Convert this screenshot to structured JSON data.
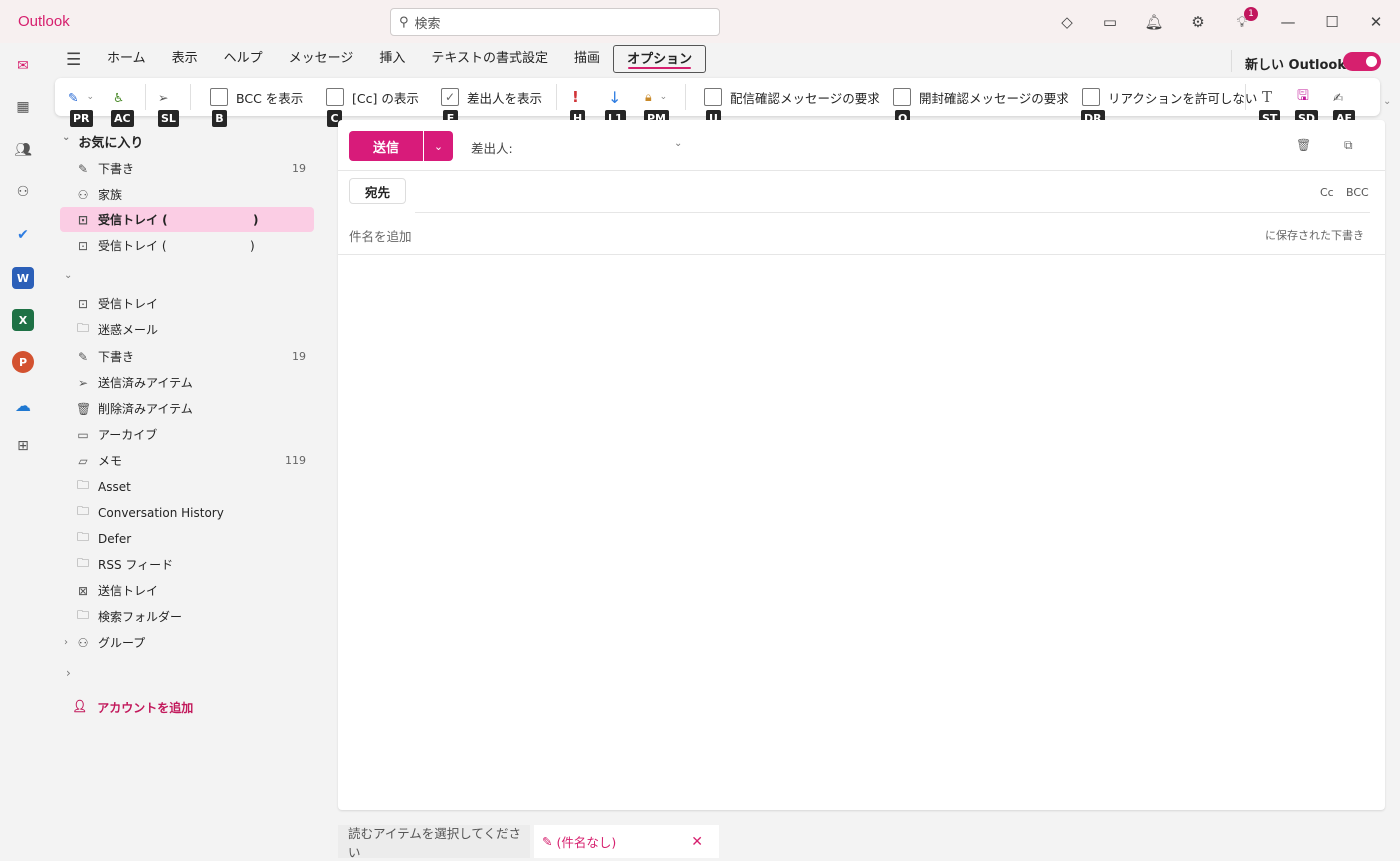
{
  "app": {
    "title": "Outlook",
    "accent": "#d6206e"
  },
  "search": {
    "placeholder": "検索"
  },
  "titlebar": {
    "notification_count": "1",
    "icons": [
      "premium-diamond-icon",
      "my-day-icon",
      "bell-icon",
      "gear-icon",
      "lightbulb-icon"
    ]
  },
  "tabs": [
    "ホーム",
    "表示",
    "ヘルプ",
    "メッセージ",
    "挿入",
    "テキストの書式設定",
    "描画",
    "オプション"
  ],
  "active_tab": "オプション",
  "new_outlook": {
    "label": "新しい Outlook",
    "enabled": true
  },
  "ribbon": {
    "bcc": {
      "label": "BCC を表示",
      "checked": false,
      "keytip": "B"
    },
    "cc": {
      "label": "[Cc] の表示",
      "checked": false,
      "keytip": "C"
    },
    "from": {
      "label": "差出人を表示",
      "checked": true,
      "keytip": "F"
    },
    "delivery": {
      "label": "配信確認メッセージの要求",
      "checked": false,
      "keytip": "U"
    },
    "read": {
      "label": "開封確認メッセージの要求",
      "checked": false,
      "keytip": "Q"
    },
    "reactions": {
      "label": "リアクションを許可しない",
      "checked": false,
      "keytip": "DR"
    },
    "keytips": {
      "pr": "PR",
      "ac": "AC",
      "sl": "SL",
      "h": "H",
      "l1": "L1",
      "pm": "PM",
      "st": "ST",
      "sd": "SD",
      "af": "AF"
    }
  },
  "folders": {
    "favorites_label": "お気に入り",
    "favorites": [
      {
        "name": "下書き",
        "count": "19"
      },
      {
        "name": "家族"
      },
      {
        "name": "受信トレイ (",
        "suffix": ")"
      },
      {
        "name": "受信トレイ (",
        "suffix": ")"
      }
    ],
    "account": [
      {
        "name": "受信トレイ"
      },
      {
        "name": "迷惑メール"
      },
      {
        "name": "下書き",
        "count": "19"
      },
      {
        "name": "送信済みアイテム"
      },
      {
        "name": "削除済みアイテム"
      },
      {
        "name": "アーカイブ"
      },
      {
        "name": "メモ",
        "count": "119"
      },
      {
        "name": "Asset"
      },
      {
        "name": "Conversation History"
      },
      {
        "name": "Defer"
      },
      {
        "name": "RSS フィード"
      },
      {
        "name": "送信トレイ"
      },
      {
        "name": "検索フォルダー"
      },
      {
        "name": "グループ"
      }
    ],
    "add_account": "アカウントを追加"
  },
  "compose": {
    "send": "送信",
    "from_label": "差出人:",
    "to": "宛先",
    "cc": "Cc",
    "bcc": "BCC",
    "subject_placeholder": "件名を追加",
    "saved_status": "に保存された下書き"
  },
  "bottom": {
    "reading_hint": "読むアイテムを選択してください",
    "draft_tab": "(件名なし)"
  }
}
